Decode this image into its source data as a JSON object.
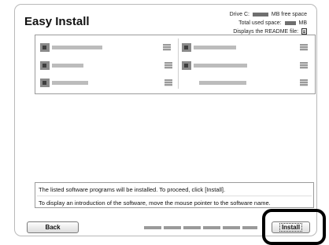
{
  "window": {
    "title": "Easy Install"
  },
  "drive_info": {
    "free_label": "Drive C:",
    "free_suffix": "MB free space",
    "used_label": "Total used space:",
    "used_suffix": "MB",
    "readme_label": "Displays the README file:"
  },
  "software_list": {
    "icon": "software-package-icon",
    "columns": 2,
    "item_count": 6
  },
  "description": {
    "line1": "The listed software programs will be installed. To proceed, click [Install].",
    "line2": "To display an introduction of the software, move the mouse pointer to the software name."
  },
  "buttons": {
    "back_label": "Back",
    "install_label": "Install"
  },
  "highlight": {
    "color": "#000000",
    "target": "Install"
  }
}
